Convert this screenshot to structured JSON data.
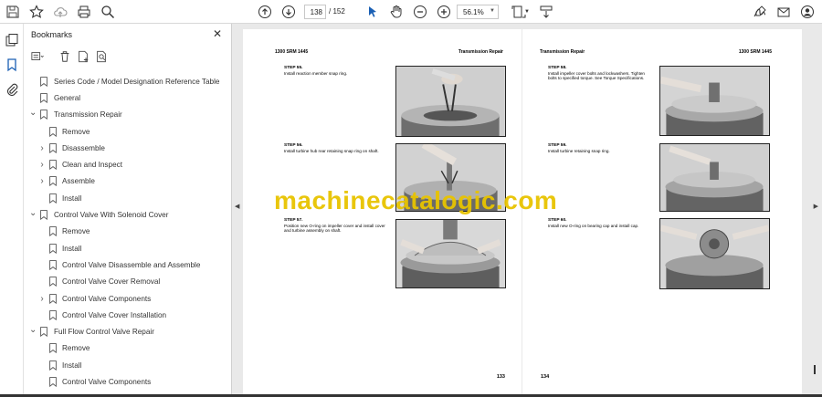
{
  "toolbar": {
    "page_current": "138",
    "page_total": "/ 152",
    "zoom": "56.1%"
  },
  "panel": {
    "title": "Bookmarks",
    "items": [
      {
        "label": "Series Code / Model Designation Reference Table",
        "level": 0,
        "caret": ""
      },
      {
        "label": "General",
        "level": 0,
        "caret": ""
      },
      {
        "label": "Transmission Repair",
        "level": 0,
        "caret": "down"
      },
      {
        "label": "Remove",
        "level": 1,
        "caret": ""
      },
      {
        "label": "Disassemble",
        "level": 1,
        "caret": "right"
      },
      {
        "label": "Clean and Inspect",
        "level": 1,
        "caret": "right"
      },
      {
        "label": "Assemble",
        "level": 1,
        "caret": "right"
      },
      {
        "label": "Install",
        "level": 1,
        "caret": ""
      },
      {
        "label": "Control Valve With Solenoid Cover",
        "level": 0,
        "caret": "down"
      },
      {
        "label": "Remove",
        "level": 1,
        "caret": ""
      },
      {
        "label": "Install",
        "level": 1,
        "caret": ""
      },
      {
        "label": "Control Valve Disassemble and Assemble",
        "level": 1,
        "caret": ""
      },
      {
        "label": "Control Valve Cover Removal",
        "level": 1,
        "caret": ""
      },
      {
        "label": "Control Valve Components",
        "level": 1,
        "caret": "right"
      },
      {
        "label": "Control Valve Cover Installation",
        "level": 1,
        "caret": ""
      },
      {
        "label": "Full Flow Control Valve Repair",
        "level": 0,
        "caret": "down"
      },
      {
        "label": "Remove",
        "level": 1,
        "caret": ""
      },
      {
        "label": "Install",
        "level": 1,
        "caret": ""
      },
      {
        "label": "Control Valve Components",
        "level": 1,
        "caret": ""
      }
    ]
  },
  "document": {
    "left_page": {
      "header_left": "1300 SRM 1445",
      "header_right": "Transmission Repair",
      "page_number": "133",
      "steps": [
        {
          "title": "STEP 55.",
          "text": "Install reaction member snap ring."
        },
        {
          "title": "STEP 56.",
          "text": "Install turbine hub rear retaining snap ring on shaft."
        },
        {
          "title": "STEP 57.",
          "text": "Position new O-ring on impeller cover and install cover and turbine assembly on shaft."
        }
      ]
    },
    "right_page": {
      "header_left": "Transmission Repair",
      "header_right": "1300 SRM 1445",
      "page_number": "134",
      "steps": [
        {
          "title": "STEP 58.",
          "text": "Install impeller cover bolts and lockwashers. Tighten bolts to specified torque. See Torque Specifications."
        },
        {
          "title": "STEP 59.",
          "text": "Install turbine retaining snap ring."
        },
        {
          "title": "STEP 60.",
          "text": "Install new O-ring on bearing cap and install cap."
        }
      ]
    },
    "watermark": "machinecatalogic.com"
  }
}
